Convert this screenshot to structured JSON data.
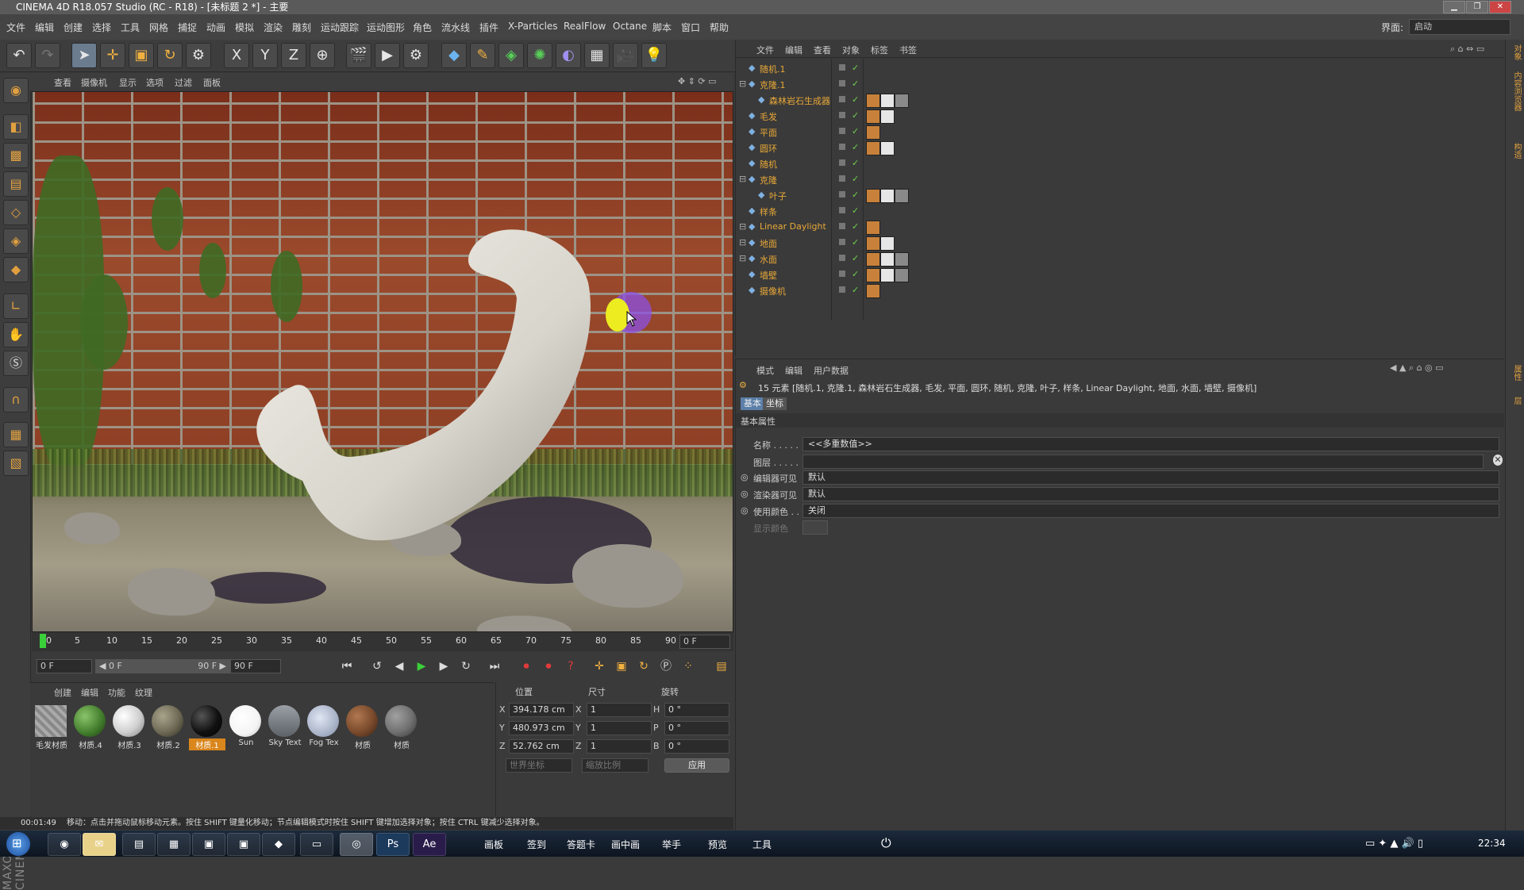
{
  "window": {
    "title": "CINEMA 4D R18.057 Studio (RC - R18) - [未标题 2 *] - 主要",
    "layout_label": "界面:",
    "layout_value": "启动",
    "minimize": "▁",
    "maximize": "❐",
    "close": "✕"
  },
  "menu": [
    "文件",
    "编辑",
    "创建",
    "选择",
    "工具",
    "网格",
    "捕捉",
    "动画",
    "模拟",
    "渲染",
    "雕刻",
    "运动跟踪",
    "运动图形",
    "角色",
    "流水线",
    "插件",
    "X-Particles",
    "RealFlow",
    "Octane",
    "脚本",
    "窗口",
    "帮助"
  ],
  "toolbar": {
    "icons": [
      "undo-icon",
      "redo-icon",
      "select-arrow-icon",
      "move-icon",
      "scale-icon",
      "rotate-icon",
      "recent-tool-icon",
      "x-axis-icon",
      "y-axis-icon",
      "z-axis-icon",
      "world-coord-icon",
      "render-view-icon",
      "render-picture-icon",
      "render-settings-icon",
      "cube-icon",
      "pen-icon",
      "subdivision-icon",
      "array-icon",
      "deformer-icon",
      "floor-icon",
      "camera-icon",
      "light-icon"
    ],
    "axis_labels": [
      "X",
      "Y",
      "Z"
    ]
  },
  "viewport": {
    "menu": [
      "查看",
      "摄像机",
      "显示",
      "选项",
      "过滤",
      "面板"
    ]
  },
  "timeline": {
    "ticks": [
      "0",
      "5",
      "10",
      "15",
      "20",
      "25",
      "30",
      "35",
      "40",
      "45",
      "50",
      "55",
      "60",
      "65",
      "70",
      "75",
      "80",
      "85",
      "90"
    ],
    "current_frame": "0 F",
    "start_frame": "0 F",
    "range_start": "◀ 0 F",
    "range_end": "90 F ▶",
    "end_frame": "90 F"
  },
  "materials": {
    "menu": [
      "创建",
      "编辑",
      "功能",
      "纹理"
    ],
    "items": [
      {
        "label": "毛发材质",
        "color": "#9a9a9a"
      },
      {
        "label": "材质.4",
        "color": "#3f7a2a"
      },
      {
        "label": "材质.3",
        "color": "#cfcfcf"
      },
      {
        "label": "材质.2",
        "color": "#6e6a55"
      },
      {
        "label": "材质.1",
        "color": "#111111"
      },
      {
        "label": "Sun",
        "color": "#f4f4f4"
      },
      {
        "label": "Sky Text",
        "color": "#7d8288"
      },
      {
        "label": "Fog Tex",
        "color": "#aab4c8"
      },
      {
        "label": "材质",
        "color": "#7a4a2c"
      },
      {
        "label": "材质",
        "color": "#707070"
      }
    ],
    "selected_index": 4
  },
  "coordinates": {
    "headers": [
      "位置",
      "尺寸",
      "旋转"
    ],
    "rows": [
      {
        "axis": "X",
        "pos": "394.178 cm",
        "size_axis": "X",
        "size": "1",
        "rot_axis": "H",
        "rot": "0 °"
      },
      {
        "axis": "Y",
        "pos": "480.973 cm",
        "size_axis": "Y",
        "size": "1",
        "rot_axis": "P",
        "rot": "0 °"
      },
      {
        "axis": "Z",
        "pos": "52.762 cm",
        "size_axis": "Z",
        "size": "1",
        "rot_axis": "B",
        "rot": "0 °"
      }
    ],
    "mode_select": "世界坐标",
    "scale_select": "缩放比例",
    "apply_button": "应用"
  },
  "status": {
    "time": "00:01:49",
    "message": "移动：点击并拖动鼠标移动元素。按住 SHIFT 键量化移动；节点编辑模式时按住 SHIFT 键增加选择对象；按住 CTRL 键减少选择对象。"
  },
  "object_manager": {
    "menu": [
      "文件",
      "编辑",
      "查看",
      "对象",
      "标签",
      "书签"
    ],
    "objects": [
      {
        "name": "随机.1",
        "indent": 0,
        "expand": false,
        "icon": "random-icon",
        "tags": 0
      },
      {
        "name": "克隆.1",
        "indent": 0,
        "expand": true,
        "icon": "cloner-icon",
        "tags": 0
      },
      {
        "name": "森林岩石生成器",
        "indent": 1,
        "expand": false,
        "icon": "object-icon",
        "tags": 3
      },
      {
        "name": "毛发",
        "indent": 0,
        "expand": false,
        "icon": "hair-icon",
        "tags": 2
      },
      {
        "name": "平面",
        "indent": 0,
        "expand": false,
        "icon": "plane-icon",
        "tags": 1
      },
      {
        "name": "圆环",
        "indent": 0,
        "expand": false,
        "icon": "torus-icon",
        "tags": 2
      },
      {
        "name": "随机",
        "indent": 0,
        "expand": false,
        "icon": "random-icon",
        "tags": 0
      },
      {
        "name": "克隆",
        "indent": 0,
        "expand": true,
        "icon": "cloner-icon",
        "tags": 0
      },
      {
        "name": "叶子",
        "indent": 1,
        "expand": false,
        "icon": "object-icon",
        "tags": 3
      },
      {
        "name": "样条",
        "indent": 0,
        "expand": false,
        "icon": "spline-icon",
        "tags": 0
      },
      {
        "name": "Linear Daylight",
        "indent": 0,
        "expand": true,
        "icon": "light-icon",
        "tags": 1
      },
      {
        "name": "地面",
        "indent": 0,
        "expand": true,
        "icon": "plane-icon",
        "tags": 2
      },
      {
        "name": "水面",
        "indent": 0,
        "expand": true,
        "icon": "plane-icon",
        "tags": 3
      },
      {
        "name": "墙壁",
        "indent": 0,
        "expand": false,
        "icon": "object-icon",
        "tags": 3
      },
      {
        "name": "摄像机",
        "indent": 0,
        "expand": false,
        "icon": "camera-icon",
        "tags": 1
      }
    ]
  },
  "attribute_manager": {
    "menu": [
      "模式",
      "编辑",
      "用户数据"
    ],
    "summary": "15 元素 [随机.1, 克隆.1, 森林岩石生成器, 毛发, 平面, 圆环, 随机, 克隆, 叶子, 样条, Linear Daylight, 地面, 水面, 墙壁, 摄像机]",
    "tabs": [
      "基本",
      "坐标"
    ],
    "section": "基本属性",
    "name_label": "名称 . . . . .",
    "name_value": "<<多重数值>>",
    "layer_label": "图层 . . . . .",
    "editor_visible_label": "编辑器可见",
    "editor_visible_value": "默认",
    "render_visible_label": "渲染器可见",
    "render_visible_value": "默认",
    "use_color_label": "使用颜色 . .",
    "use_color_value": "关闭",
    "display_color_label": "显示颜色"
  },
  "right_strip": [
    "对象",
    "内容浏览器",
    "构造",
    "属性",
    "层"
  ],
  "taskbar": {
    "items": [
      "画板",
      "签到",
      "答题卡",
      "画中画",
      "举手",
      "预览",
      "工具"
    ],
    "clock": "22:34"
  }
}
